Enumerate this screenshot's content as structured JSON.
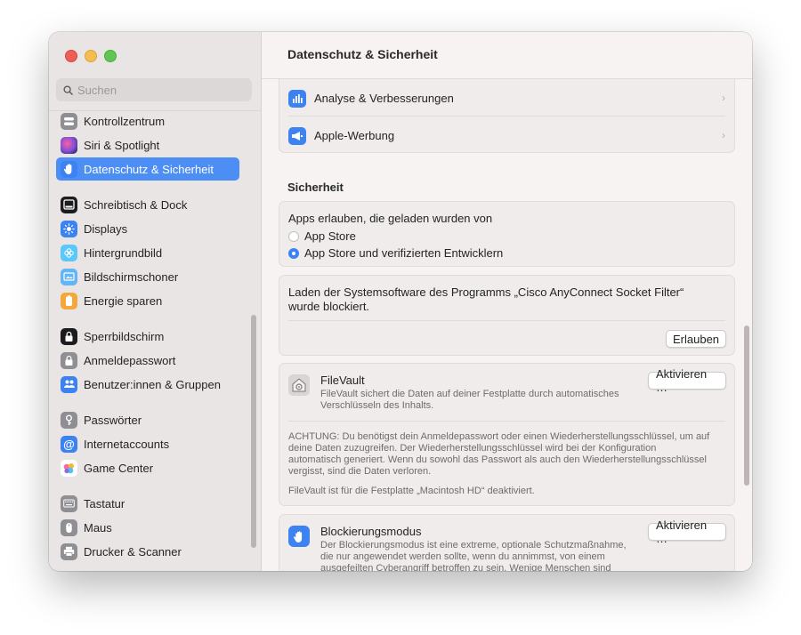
{
  "window": {
    "title": "Datenschutz & Sicherheit"
  },
  "sidebar": {
    "search_placeholder": "Suchen",
    "items": [
      {
        "label": "Kontrollzentrum",
        "icon": "control-center-icon",
        "color": "#8e8e93"
      },
      {
        "label": "Siri & Spotlight",
        "icon": "siri-icon",
        "color": "#7a4fd6"
      },
      {
        "label": "Datenschutz & Sicherheit",
        "icon": "hand-icon",
        "color": "#3c82f0",
        "selected": true
      },
      {
        "label": "Schreibtisch & Dock",
        "icon": "dock-icon",
        "color": "#1c1c1e"
      },
      {
        "label": "Displays",
        "icon": "display-icon",
        "color": "#3c82f0"
      },
      {
        "label": "Hintergrundbild",
        "icon": "wallpaper-icon",
        "color": "#5ac8fa"
      },
      {
        "label": "Bildschirmschoner",
        "icon": "screensaver-icon",
        "color": "#64b5f6"
      },
      {
        "label": "Energie sparen",
        "icon": "battery-icon",
        "color": "#f4a83a"
      },
      {
        "label": "Sperrbildschirm",
        "icon": "lock-screen-icon",
        "color": "#1c1c1e"
      },
      {
        "label": "Anmeldepasswort",
        "icon": "lock-icon",
        "color": "#8e8e93"
      },
      {
        "label": "Benutzer:innen & Gruppen",
        "icon": "users-icon",
        "color": "#3c82f0"
      },
      {
        "label": "Passwörter",
        "icon": "key-icon",
        "color": "#8e8e93"
      },
      {
        "label": "Internetaccounts",
        "icon": "at-icon",
        "color": "#3c82f0"
      },
      {
        "label": "Game Center",
        "icon": "game-center-icon",
        "color": "#ffffff"
      },
      {
        "label": "Tastatur",
        "icon": "keyboard-icon",
        "color": "#8e8e93"
      },
      {
        "label": "Maus",
        "icon": "mouse-icon",
        "color": "#8e8e93"
      },
      {
        "label": "Drucker & Scanner",
        "icon": "printer-icon",
        "color": "#8e8e93"
      }
    ]
  },
  "main": {
    "privacy_rows": [
      {
        "label": "Analyse & Verbesserungen",
        "icon": "chart-icon"
      },
      {
        "label": "Apple-Werbung",
        "icon": "megaphone-icon"
      }
    ],
    "security": {
      "title": "Sicherheit",
      "apps_allowed_label": "Apps erlauben, die geladen wurden von",
      "options": [
        {
          "label": "App Store",
          "selected": false
        },
        {
          "label": "App Store und verifizierten Entwicklern",
          "selected": true
        }
      ]
    },
    "blocked": {
      "line1": "Laden der Systemsoftware des Programms „Cisco AnyConnect Socket Filter“",
      "line2": "wurde blockiert.",
      "button": "Erlauben"
    },
    "filevault": {
      "title": "FileVault",
      "desc1": "FileVault sichert die Daten auf deiner Festplatte durch automatisches",
      "desc2": "Verschlüsseln des Inhalts.",
      "button": "Aktivieren …",
      "warn1": "ACHTUNG: Du benötigst dein Anmeldepasswort oder einen Wiederherstellungsschlüssel, um auf",
      "warn2": "deine Daten zuzugreifen. Der Wiederherstellungsschlüssel wird bei der Konfiguration",
      "warn3": "automatisch generiert. Wenn du sowohl das Passwort als auch den Wiederherstellungsschlüssel",
      "warn4": "vergisst, sind die Daten verloren.",
      "status": "FileVault ist für die Festplatte „Macintosh HD“ deaktiviert."
    },
    "lockdown": {
      "title": "Blockierungsmodus",
      "desc1": "Der Blockierungsmodus ist eine extreme, optionale Schutzmaßnahme,",
      "desc2": "die nur angewendet werden sollte, wenn du annimmst, von einem",
      "desc3": "ausgefeilten Cyberangriff betroffen zu sein. Wenige Menschen sind",
      "button": "Aktivieren …"
    }
  }
}
